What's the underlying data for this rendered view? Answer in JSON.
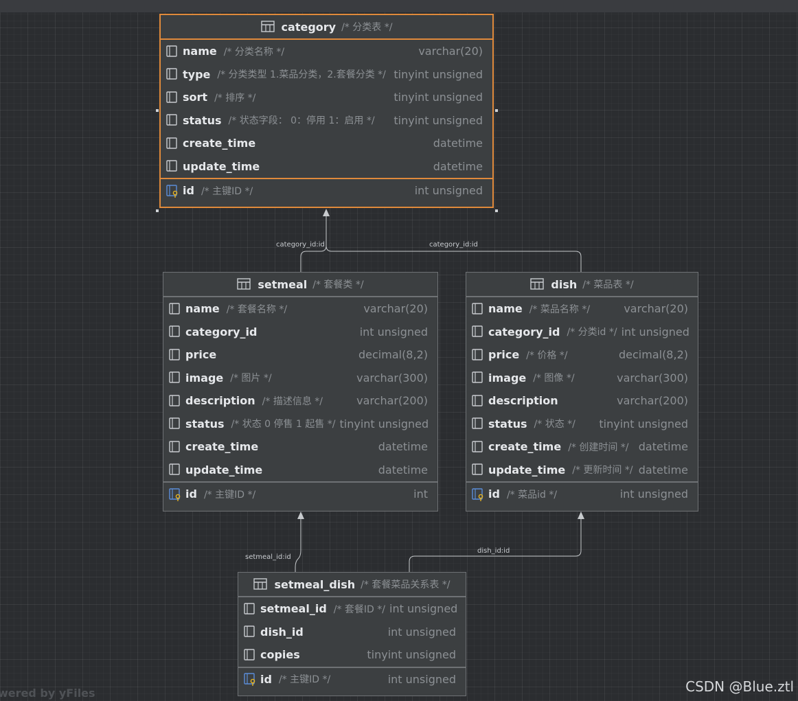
{
  "tables": {
    "category": {
      "name": "category",
      "comment": "/* 分类表 */",
      "columns": [
        {
          "name": "name",
          "comment": "/* 分类名称 */",
          "type": "varchar(20)"
        },
        {
          "name": "type",
          "comment": "/* 分类类型 1.菜品分类，2.套餐分类 */",
          "type": "tinyint unsigned"
        },
        {
          "name": "sort",
          "comment": "/* 排序 */",
          "type": "tinyint unsigned"
        },
        {
          "name": "status",
          "comment": "/* 状态字段： 0：停用 1：启用 */",
          "type": "tinyint unsigned"
        },
        {
          "name": "create_time",
          "comment": "",
          "type": "datetime"
        },
        {
          "name": "update_time",
          "comment": "",
          "type": "datetime"
        }
      ],
      "pk": {
        "name": "id",
        "comment": "/* 主键ID */",
        "type": "int unsigned"
      }
    },
    "setmeal": {
      "name": "setmeal",
      "comment": "/* 套餐类 */",
      "columns": [
        {
          "name": "name",
          "comment": "/* 套餐名称 */",
          "type": "varchar(20)"
        },
        {
          "name": "category_id",
          "comment": "",
          "type": "int unsigned"
        },
        {
          "name": "price",
          "comment": "",
          "type": "decimal(8,2)"
        },
        {
          "name": "image",
          "comment": "/* 图片 */",
          "type": "varchar(300)"
        },
        {
          "name": "description",
          "comment": "/* 描述信息 */",
          "type": "varchar(200)"
        },
        {
          "name": "status",
          "comment": "/* 状态 0 停售 1 起售 */",
          "type": "tinyint unsigned"
        },
        {
          "name": "create_time",
          "comment": "",
          "type": "datetime"
        },
        {
          "name": "update_time",
          "comment": "",
          "type": "datetime"
        }
      ],
      "pk": {
        "name": "id",
        "comment": "/* 主键ID */",
        "type": "int"
      }
    },
    "dish": {
      "name": "dish",
      "comment": "/* 菜品表 */",
      "columns": [
        {
          "name": "name",
          "comment": "/* 菜品名称 */",
          "type": "varchar(20)"
        },
        {
          "name": "category_id",
          "comment": "/* 分类id */",
          "type": "int unsigned"
        },
        {
          "name": "price",
          "comment": "/* 价格 */",
          "type": "decimal(8,2)"
        },
        {
          "name": "image",
          "comment": "/* 图像 */",
          "type": "varchar(300)"
        },
        {
          "name": "description",
          "comment": "",
          "type": "varchar(200)"
        },
        {
          "name": "status",
          "comment": "/* 状态 */",
          "type": "tinyint unsigned"
        },
        {
          "name": "create_time",
          "comment": "/* 创建时间 */",
          "type": "datetime"
        },
        {
          "name": "update_time",
          "comment": "/* 更新时间 */",
          "type": "datetime"
        }
      ],
      "pk": {
        "name": "id",
        "comment": "/* 菜品id */",
        "type": "int unsigned"
      }
    },
    "setmeal_dish": {
      "name": "setmeal_dish",
      "comment": "/* 套餐菜品关系表 */",
      "columns": [
        {
          "name": "setmeal_id",
          "comment": "/* 套餐ID */",
          "type": "int unsigned"
        },
        {
          "name": "dish_id",
          "comment": "",
          "type": "int unsigned"
        },
        {
          "name": "copies",
          "comment": "",
          "type": "tinyint unsigned"
        }
      ],
      "pk": {
        "name": "id",
        "comment": "/* 主键ID */",
        "type": "int unsigned"
      }
    }
  },
  "edge_labels": {
    "setmeal_category": "category_id:id",
    "dish_category": "category_id:id",
    "setmealdish_setmeal": "setmeal_id:id",
    "setmealdish_dish": "dish_id:id"
  },
  "watermark": "owered by yFiles",
  "credit": "CSDN @Blue.ztl",
  "colors": {
    "selected_border": "#e08a3b",
    "background": "#2b2d30",
    "table_bg": "#3c3f41"
  }
}
